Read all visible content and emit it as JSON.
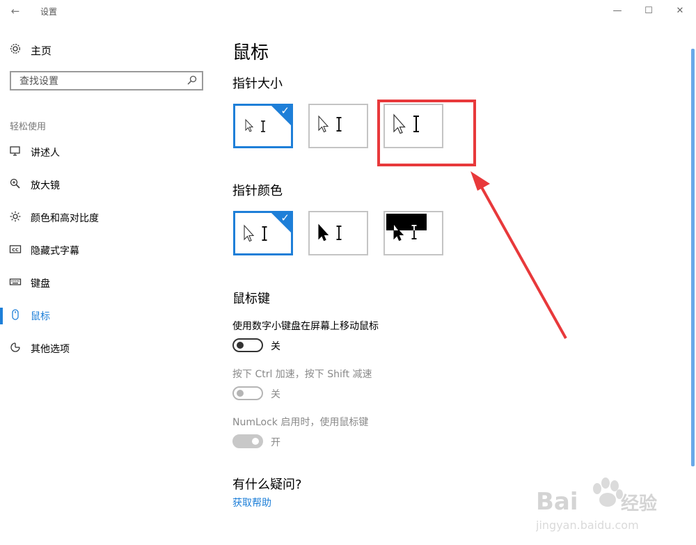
{
  "window": {
    "title": "设置",
    "back_glyph": "←",
    "min_glyph": "—",
    "max_glyph": "☐",
    "close_glyph": "✕"
  },
  "sidebar": {
    "home_label": "主页",
    "search_placeholder": "查找设置",
    "group_label": "轻松使用",
    "items": [
      {
        "label": "讲述人",
        "icon": "narrator-icon"
      },
      {
        "label": "放大镜",
        "icon": "magnifier-icon"
      },
      {
        "label": "颜色和高对比度",
        "icon": "brightness-icon"
      },
      {
        "label": "隐藏式字幕",
        "icon": "cc-icon"
      },
      {
        "label": "键盘",
        "icon": "keyboard-icon"
      },
      {
        "label": "鼠标",
        "icon": "mouse-icon",
        "active": true
      },
      {
        "label": "其他选项",
        "icon": "other-options-icon"
      }
    ]
  },
  "main": {
    "title": "鼠标",
    "pointer_size": {
      "heading": "指针大小",
      "selected_index": 0
    },
    "pointer_color": {
      "heading": "指针颜色",
      "selected_index": 0
    },
    "mouse_keys": {
      "heading": "鼠标键",
      "numpad_label": "使用数字小键盘在屏幕上移动鼠标",
      "numpad_state": "关",
      "ctrl_shift_label": "按下 Ctrl 加速，按下 Shift 减速",
      "ctrl_shift_state": "关",
      "numlock_label": "NumLock 启用时，使用鼠标键",
      "numlock_state": "开"
    },
    "faq": {
      "heading": "有什么疑问?",
      "link": "获取帮助"
    }
  },
  "colors": {
    "accent": "#1e7fd8",
    "annotation": "#e8393b"
  }
}
